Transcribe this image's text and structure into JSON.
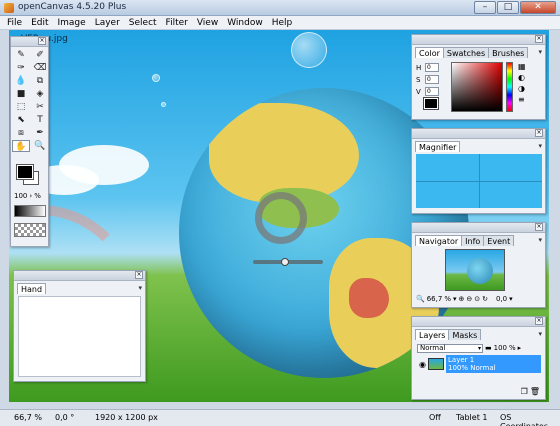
{
  "window": {
    "title": "openCanvas 4.5.20 Plus",
    "min": "–",
    "max": "□",
    "close": "✕"
  },
  "menu": [
    "File",
    "Edit",
    "Image",
    "Layer",
    "Select",
    "Filter",
    "View",
    "Window",
    "Help"
  ],
  "document": {
    "tab_label": "VER.ru.jpg"
  },
  "toolbox": {
    "tools": [
      "✎",
      "✐",
      "✑",
      "⌫",
      "💧",
      "⧉",
      "■",
      "◈",
      "⬚",
      "✂",
      "⬉",
      "T",
      "⧈",
      "✒",
      "✋",
      "🔍"
    ],
    "opacity": "100",
    "opacity_unit": "%"
  },
  "color_panel": {
    "tabs": [
      "Color",
      "Swatches",
      "Brushes"
    ],
    "h_label": "H",
    "h_value": "0",
    "s_label": "S",
    "s_value": "0",
    "v_label": "V",
    "v_value": "0"
  },
  "magnifier_panel": {
    "tabs": [
      "Magnifier"
    ]
  },
  "navigator_panel": {
    "tabs": [
      "Navigator",
      "Info",
      "Event"
    ],
    "zoom": "66,7",
    "zoom_unit": "%",
    "angle": "0,0"
  },
  "layers_panel": {
    "tabs": [
      "Layers",
      "Masks"
    ],
    "blend_mode": "Normal",
    "opacity": "100",
    "opacity_unit": "%",
    "layer_name": "Layer 1",
    "layer_desc": "100% Normal"
  },
  "hand_panel": {
    "tabs": [
      "Hand"
    ]
  },
  "status": {
    "zoom": "66,7 %",
    "angle": "0,0 °",
    "size": "1920 x 1200 px",
    "state": "Off",
    "tablet": "Tablet 1",
    "coords": "OS Coordinates"
  }
}
